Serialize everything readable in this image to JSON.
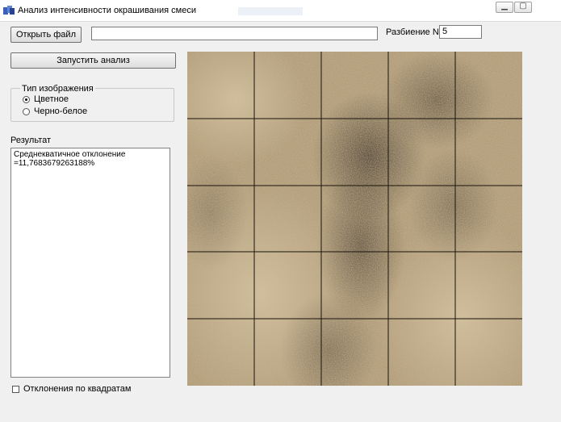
{
  "window": {
    "title": "Анализ интенсивности окрашивания смеси",
    "app_icon": "app-icon"
  },
  "toolbar": {
    "open_file_label": "Открыть файл",
    "file_path_value": "",
    "partition_label": "Разбиение N=",
    "partition_value": "5"
  },
  "analysis": {
    "run_label": "Запустить анализ"
  },
  "image_type": {
    "legend": "Тип изображения",
    "options": [
      {
        "label": "Цветное",
        "checked": true
      },
      {
        "label": "Черно-белое",
        "checked": false
      }
    ]
  },
  "result": {
    "label": "Результат",
    "line1": "Среднекватичное отклонение",
    "line2": "=11,7683679263188%"
  },
  "deviations_checkbox": {
    "label": "Отклонения по квадратам",
    "checked": false
  },
  "image_grid": {
    "divisions": 5,
    "line_color": "#1a140c"
  }
}
